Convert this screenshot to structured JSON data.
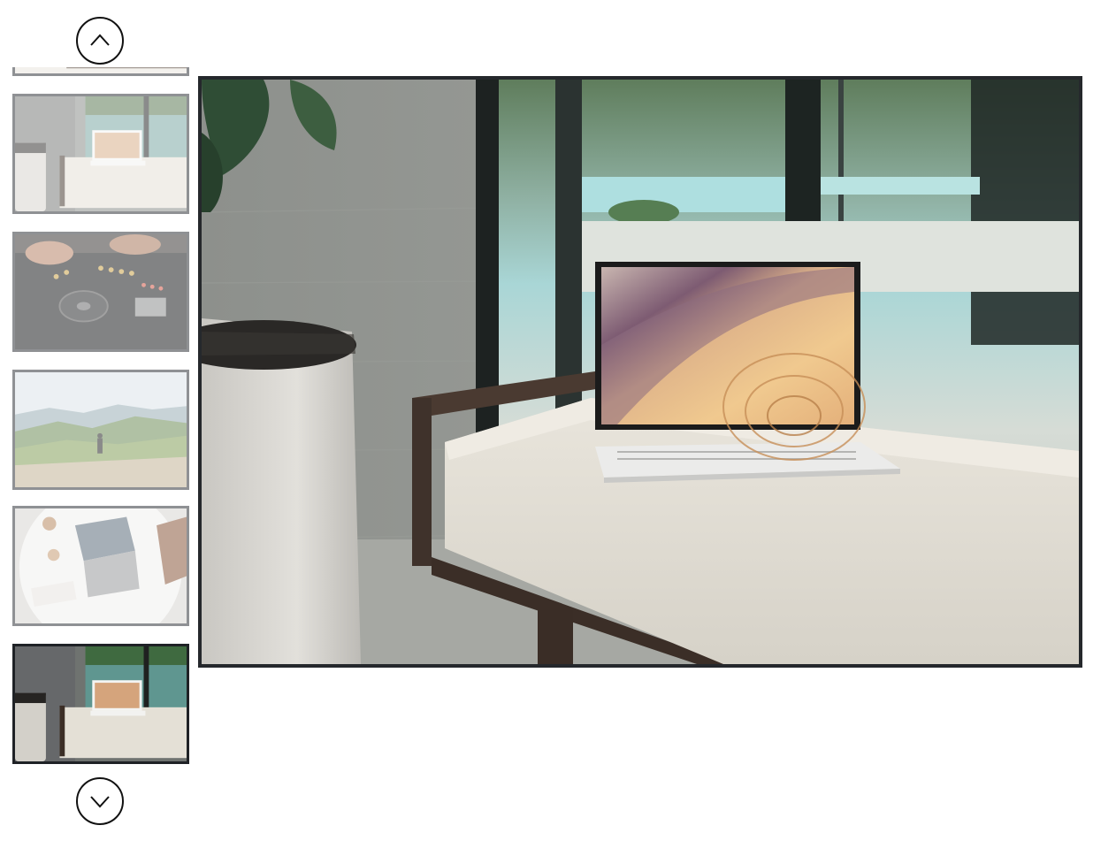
{
  "gallery": {
    "scroll_up_icon": "chevron-up-icon",
    "scroll_down_icon": "chevron-down-icon",
    "selected_index": 5,
    "thumbnails": [
      {
        "name": "thumbnail-partial",
        "scene": "laptop-on-bench"
      },
      {
        "name": "thumbnail-laptop-bench",
        "scene": "laptop-on-bench"
      },
      {
        "name": "thumbnail-dj-mixer",
        "scene": "dj-controller"
      },
      {
        "name": "thumbnail-mountain-hiker",
        "scene": "mountain-landscape"
      },
      {
        "name": "thumbnail-desk-laptop",
        "scene": "desk-top-view"
      },
      {
        "name": "thumbnail-laptop-bench-selected",
        "scene": "laptop-on-bench"
      }
    ],
    "main_image": "laptop-on-bench"
  },
  "colors": {
    "active_border": "#1f2226",
    "inactive_border": "#8f9194"
  }
}
